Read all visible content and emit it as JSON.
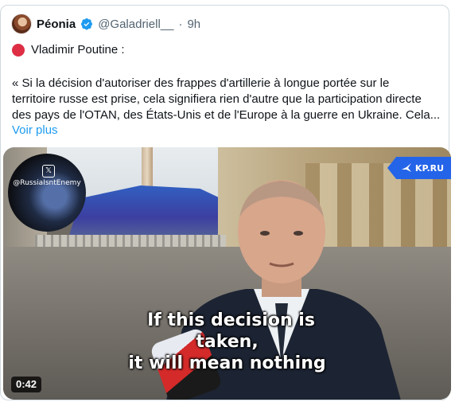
{
  "tweet": {
    "author": {
      "display_name": "Péonia",
      "handle": "@Galadriell__",
      "separator": "·",
      "time": "9h",
      "verified": true
    },
    "first_line": {
      "emoji": "red-circle-icon",
      "text": "Vladimir Poutine :"
    },
    "body_lines": [
      "« Si la décision d'autoriser des frappes d'artillerie à longue portée sur le",
      "territoire russe est prise, cela signifiera rien d'autre que la participation directe",
      "des pays de l'OTAN, des États-Unis et de l'Europe à la guerre en Ukraine. Cela..."
    ],
    "show_more": "Voir plus"
  },
  "media": {
    "pip_handle": "@RussiaIsntEnemy",
    "pip_icon": "x-logo-icon",
    "badge": "KP.RU",
    "subtitle_lines": [
      "If this decision is",
      "taken,",
      "it will mean nothing"
    ],
    "duration": "0:42"
  },
  "colors": {
    "link": "#1d9bf0",
    "verified": "#1d9bf0",
    "muted": "#536471",
    "badge": "#2464e8"
  }
}
